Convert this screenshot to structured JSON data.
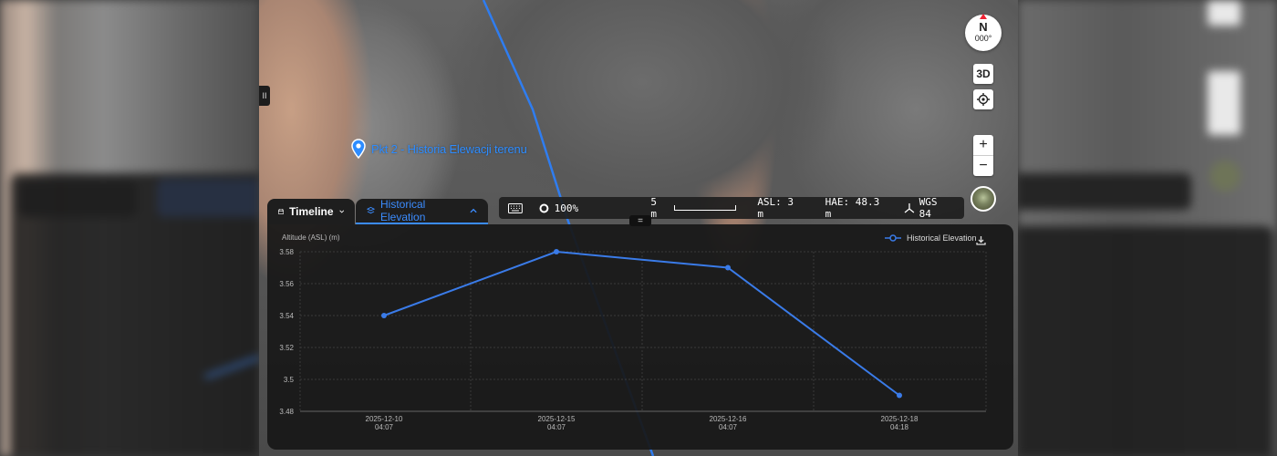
{
  "map": {
    "point_label": "Pkt 2 - Historia Elewacji terenu",
    "compass": {
      "north": "N",
      "heading": "000°"
    },
    "buttons": {
      "mode_3d": "3D",
      "zoom_in": "+",
      "zoom_out": "−"
    },
    "icons": [
      "location-pin-icon",
      "locate-icon",
      "compass-icon",
      "globe-icon",
      "keyboard-icon",
      "opacity-circle-icon",
      "coordinate-system-icon",
      "download-icon",
      "calendar-icon",
      "chevron-down-icon",
      "chevron-up-icon"
    ]
  },
  "tabs": {
    "timeline": "Timeline",
    "historical": "Historical Elevation"
  },
  "infobar": {
    "opacity": "100%",
    "scale": "5 m",
    "asl": "ASL: 3 m",
    "hae": "HAE: 48.3 m",
    "crs": "WGS 84"
  },
  "colors": {
    "accent": "#3b8cff",
    "panel": "#181818",
    "line": "#3a7be8"
  },
  "chart_data": {
    "type": "line",
    "ylabel": "Altitude (ASL) (m)",
    "xlabel": "",
    "ylim": [
      3.48,
      3.58
    ],
    "yticks": [
      "3.58",
      "3.56",
      "3.54",
      "3.52",
      "3.5",
      "3.48"
    ],
    "categories": [
      {
        "date": "2025-12-10",
        "time": "04:07"
      },
      {
        "date": "2025-12-15",
        "time": "04:07"
      },
      {
        "date": "2025-12-16",
        "time": "04:07"
      },
      {
        "date": "2025-12-18",
        "time": "04:18"
      }
    ],
    "series": [
      {
        "name": "Historical Elevation",
        "values": [
          3.54,
          3.58,
          3.57,
          3.49
        ]
      }
    ],
    "grid": true,
    "legend": "top-right"
  }
}
